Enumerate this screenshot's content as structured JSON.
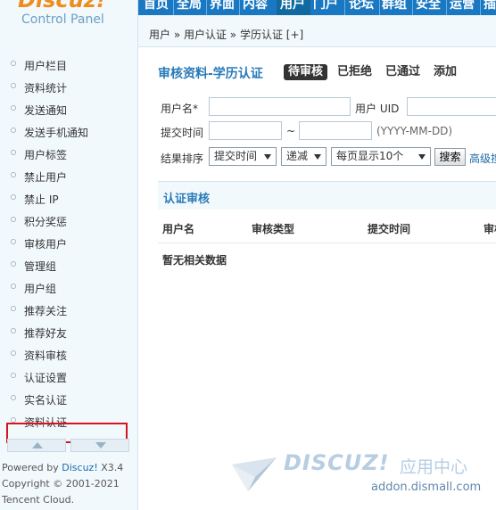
{
  "logo": {
    "brand": "Discuz!",
    "subtitle": "Control Panel"
  },
  "topnav": {
    "items": [
      {
        "label": "首页"
      },
      {
        "label": "全局"
      },
      {
        "label": "界面"
      },
      {
        "label": "内容"
      },
      {
        "label": "用户",
        "active": true
      },
      {
        "label": "门户"
      },
      {
        "label": "论坛"
      },
      {
        "label": "群组"
      },
      {
        "label": "安全"
      },
      {
        "label": "运营"
      },
      {
        "label": "插件"
      }
    ]
  },
  "breadcrumb": {
    "text": "用户 » 用户认证 » 学历认证  [+]"
  },
  "sidebar": {
    "items": [
      {
        "label": "用户栏目"
      },
      {
        "label": "资料统计"
      },
      {
        "label": "发送通知"
      },
      {
        "label": "发送手机通知"
      },
      {
        "label": "用户标签"
      },
      {
        "label": "禁止用户"
      },
      {
        "label": "禁止 IP"
      },
      {
        "label": "积分奖惩"
      },
      {
        "label": "审核用户"
      },
      {
        "label": "管理组"
      },
      {
        "label": "用户组"
      },
      {
        "label": "推荐关注"
      },
      {
        "label": "推荐好友"
      },
      {
        "label": "资料审核"
      },
      {
        "label": "认证设置"
      },
      {
        "label": "实名认证"
      },
      {
        "label": "资料认证"
      }
    ]
  },
  "footer": {
    "line1_prefix": "Powered by ",
    "line1_link": "Discuz!",
    "line1_suffix": " X3.4",
    "line2": "Copyright © 2001-2021",
    "line3": "Tencent Cloud."
  },
  "main": {
    "title": "审核资料-学历认证",
    "tabs": [
      {
        "label": "待审核",
        "active": true
      },
      {
        "label": "已拒绝"
      },
      {
        "label": "已通过"
      },
      {
        "label": "添加"
      }
    ]
  },
  "filters": {
    "username_label": "用户名*",
    "uid_label": "用户 UID",
    "time_label": "提交时间",
    "time_sep": "~",
    "time_hint": "(YYYY-MM-DD)",
    "sort_label": "结果排序",
    "sort_field": "提交时间",
    "sort_order": "递减",
    "per_page": "每页显示10个",
    "search_button": "搜索",
    "advanced_link": "高级搜索"
  },
  "section": {
    "title": "认证审核"
  },
  "table": {
    "headers": [
      "用户名",
      "审核类型",
      "提交时间",
      "审核"
    ],
    "empty_text": "暂无相关数据"
  },
  "watermark": {
    "logo": "DISCUZ!",
    "text": "应用中心",
    "url": "addon.dismall.com"
  },
  "colors": {
    "nav_blue": "#1a78c2",
    "panel_bg": "#f2f9fd",
    "title_blue": "#2a7ab8",
    "highlight_red": "#d7141d"
  }
}
